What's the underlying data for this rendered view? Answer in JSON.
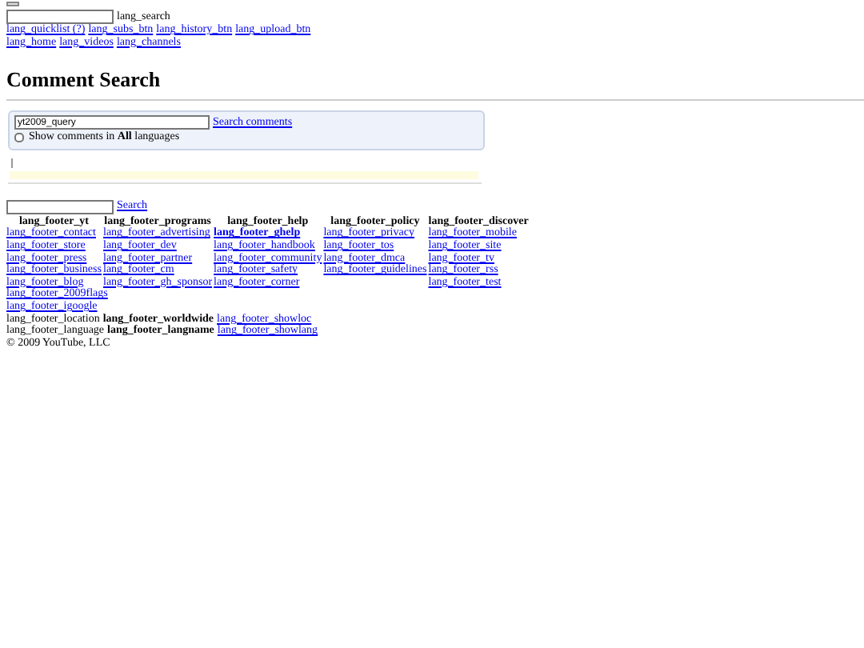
{
  "masthead": {
    "search_label": "lang_search",
    "nav_links": [
      [
        "lang_quicklist (?)",
        "lang_subs_btn",
        "lang_history_btn",
        "lang_upload_btn"
      ],
      [
        "lang_home",
        "lang_videos",
        "lang_channels"
      ]
    ]
  },
  "page_title": "Comment Search",
  "search_panel": {
    "value": "yt2009_query",
    "submit": "Search comments",
    "all_languages": {
      "checked": false,
      "label": "Show comments in **All** languages"
    }
  },
  "footer_search": {
    "submit": "Search"
  },
  "footer_columns": [
    {
      "heading": "lang_footer_yt",
      "links": [
        {
          "text": "lang_footer_contact",
          "bold": false
        },
        {
          "text": "lang_footer_store",
          "bold": false
        },
        {
          "text": "lang_footer_press",
          "bold": false
        },
        {
          "text": "lang_footer_business",
          "bold": false
        },
        {
          "text": "lang_footer_blog",
          "bold": false
        }
      ]
    },
    {
      "heading": "lang_footer_programs",
      "links": [
        {
          "text": "lang_footer_advertising",
          "bold": false
        },
        {
          "text": "lang_footer_dev",
          "bold": false
        },
        {
          "text": "lang_footer_partner",
          "bold": false
        },
        {
          "text": "lang_footer_cm",
          "bold": false
        },
        {
          "text": "lang_footer_gh_sponsor",
          "bold": false
        }
      ]
    },
    {
      "heading": "lang_footer_help",
      "links": [
        {
          "text": "lang_footer_ghelp",
          "bold": true
        },
        {
          "text": "lang_footer_handbook",
          "bold": false
        },
        {
          "text": "lang_footer_community",
          "bold": false
        },
        {
          "text": "lang_footer_safety",
          "bold": false
        },
        {
          "text": "lang_footer_corner",
          "bold": false
        }
      ]
    },
    {
      "heading": "lang_footer_policy",
      "links": [
        {
          "text": "lang_footer_privacy",
          "bold": false
        },
        {
          "text": "lang_footer_tos",
          "bold": false
        },
        {
          "text": "lang_footer_dmca",
          "bold": false
        },
        {
          "text": "lang_footer_guidelines",
          "bold": false
        }
      ]
    },
    {
      "heading": "lang_footer_discover",
      "links": [
        {
          "text": "lang_footer_mobile",
          "bold": false
        },
        {
          "text": "lang_footer_site",
          "bold": false
        },
        {
          "text": "lang_footer_tv",
          "bold": false
        },
        {
          "text": "lang_footer_rss",
          "bold": false
        },
        {
          "text": "lang_footer_test",
          "bold": false
        }
      ]
    }
  ],
  "footer_extra_links": [
    "lang_footer_2009flags",
    "lang_footer_igoogle"
  ],
  "footer_settings": [
    {
      "label": "lang_footer_location",
      "value": "lang_footer_worldwide",
      "link": "lang_footer_showloc"
    },
    {
      "label": "lang_footer_language",
      "value": "lang_footer_langname",
      "link": "lang_footer_showlang"
    }
  ],
  "copyright": "© 2009 YouTube, LLC"
}
